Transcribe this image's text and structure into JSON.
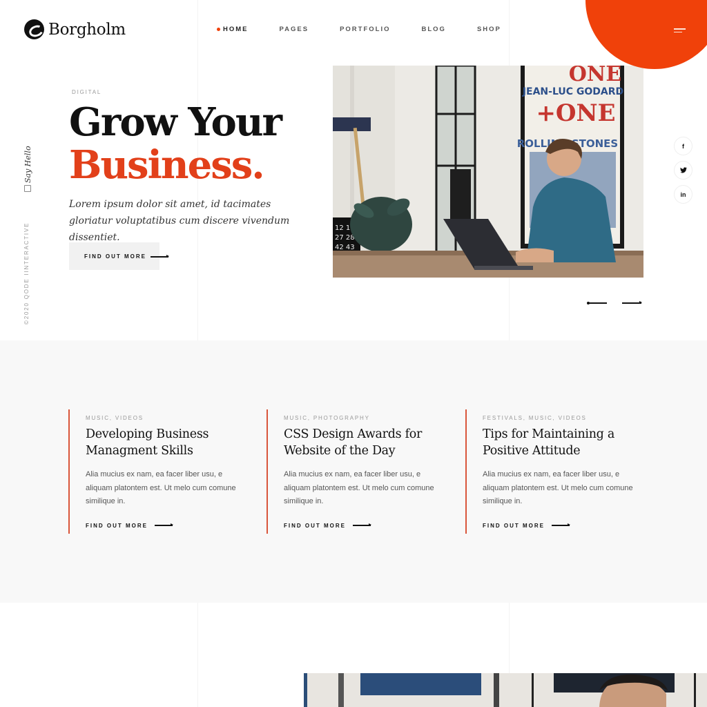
{
  "brand": {
    "name": "Borgholm",
    "accent": "#f0410a"
  },
  "nav": {
    "items": [
      {
        "label": "HOME",
        "active": true
      },
      {
        "label": "PAGES",
        "active": false
      },
      {
        "label": "PORTFOLIO",
        "active": false
      },
      {
        "label": "BLOG",
        "active": false
      },
      {
        "label": "SHOP",
        "active": false
      }
    ],
    "menu_icon": "hamburger-icon"
  },
  "side": {
    "say_hello": "Say Hello",
    "chat_icon": "chat-icon",
    "copyright": "©2020 QODE IINTERACTIVE"
  },
  "hero": {
    "eyebrow": "DIGITAL",
    "title_line1": "Grow Your",
    "title_line2": "Business.",
    "subtitle": "Lorem ipsum dolor sit amet, id tacimates gloriatur voluptatibus cum discere vivendum dissentiet.",
    "button_label": "FIND OUT MORE",
    "image_alt": "Man working on a laptop at a wooden table in front of a Jean-Luc Godard One+One poster",
    "poster_text": [
      "ONE",
      "JEAN-LUC GODARD",
      "+ONE",
      "ROLLING STONES"
    ]
  },
  "social": [
    {
      "name": "facebook",
      "glyph": "f"
    },
    {
      "name": "twitter",
      "glyph": "🐦"
    },
    {
      "name": "linkedin",
      "glyph": "in"
    }
  ],
  "posts": [
    {
      "categories": "MUSIC, VIDEOS",
      "title": "Developing Business Managment Skills",
      "excerpt": "Alia mucius ex nam, ea facer liber usu, e aliquam platontem est. Ut melo cum comune similique in.",
      "link_label": "FIND OUT MORE"
    },
    {
      "categories": "MUSIC, PHOTOGRAPHY",
      "title": "CSS Design Awards for Website of the Day",
      "excerpt": "Alia mucius ex nam, ea facer liber usu, e aliquam platontem est. Ut melo cum comune similique in.",
      "link_label": "FIND OUT MORE"
    },
    {
      "categories": "FESTIVALS, MUSIC, VIDEOS",
      "title": "Tips for Maintaining a Positive Attitude",
      "excerpt": "Alia mucius ex nam, ea facer liber usu, e aliquam platontem est. Ut melo cum comune similique in.",
      "link_label": "FIND OUT MORE"
    }
  ]
}
